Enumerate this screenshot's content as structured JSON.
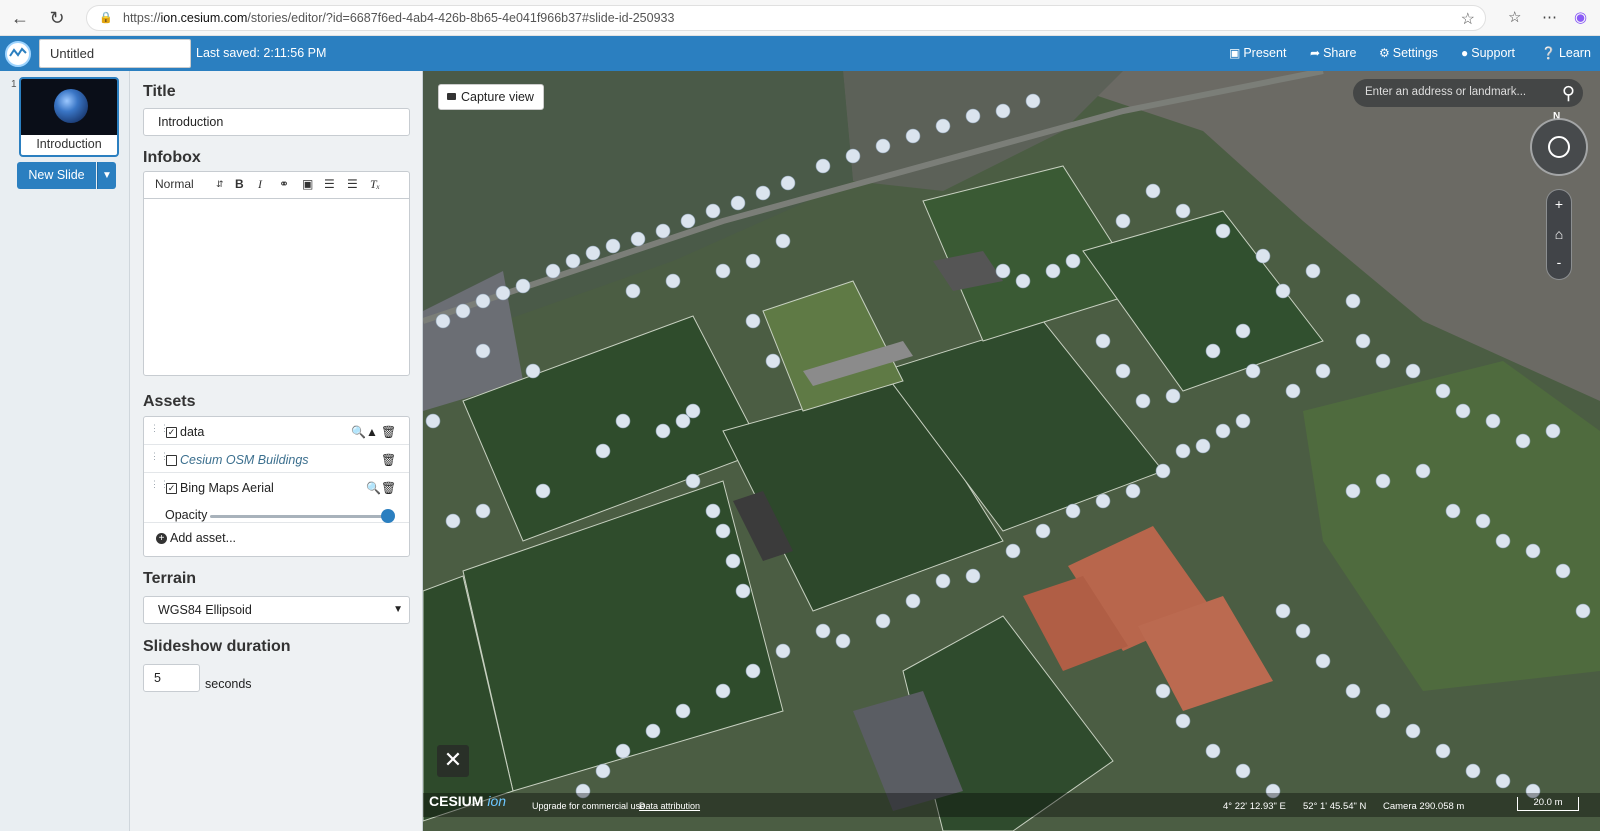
{
  "browser": {
    "url_prefix": "https://",
    "url_host": "ion.cesium.com",
    "url_rest": "/stories/editor/?id=6687f6ed-4ab4-426b-8b65-4e041f966b37#slide-id-250933"
  },
  "header": {
    "story_title": "Untitled",
    "last_saved": "Last saved: 2:11:56 PM",
    "present": "Present",
    "share": "Share",
    "settings": "Settings",
    "support": "Support",
    "learn": "Learn"
  },
  "slides": {
    "items": [
      {
        "number": "1",
        "label": "Introduction"
      }
    ],
    "new_slide": "New Slide"
  },
  "panel": {
    "title_heading": "Title",
    "title_value": "Introduction",
    "infobox_heading": "Infobox",
    "format_select": "Normal",
    "assets_heading": "Assets",
    "assets": [
      {
        "name": "data",
        "checked": true
      },
      {
        "name": "Cesium OSM Buildings",
        "checked": false
      },
      {
        "name": "Bing Maps Aerial",
        "checked": true
      }
    ],
    "opacity_label": "Opacity",
    "opacity_value": 1.0,
    "add_asset": "Add asset...",
    "terrain_heading": "Terrain",
    "terrain_value": "WGS84 Ellipsoid",
    "duration_heading": "Slideshow duration",
    "duration_value": "5",
    "duration_unit": "seconds"
  },
  "viewer": {
    "capture_view": "Capture view",
    "search_placeholder": "Enter an address or landmark...",
    "compass_label": "N",
    "zoom_in": "+",
    "zoom_out": "-",
    "logo": "CESIUM",
    "logo_suffix": "ion",
    "upgrade_text": "Upgrade for commercial use.",
    "data_attribution": "Data attribution",
    "longitude": "4° 22' 12.93\" E",
    "latitude": "52° 1' 45.54\" N",
    "camera": "Camera 290.058 m",
    "scale": "20.0 m"
  },
  "colors": {
    "header_blue": "#2b7fc0",
    "grass_dark": "#2f4a2c",
    "clay_court": "#c0644a"
  }
}
